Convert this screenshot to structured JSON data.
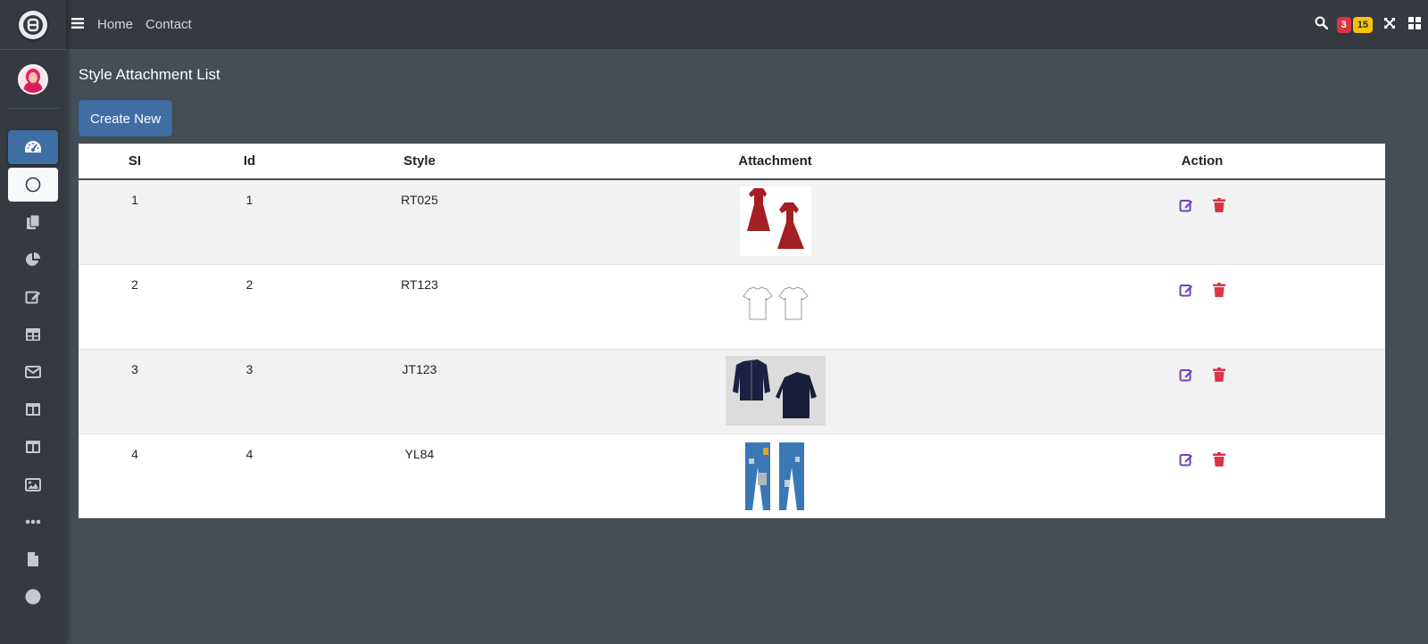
{
  "nav": {
    "links": [
      "Home",
      "Contact"
    ],
    "badges": {
      "notifications": "3",
      "messages": "15"
    }
  },
  "sidebar": {
    "icons": [
      "dashboard-icon",
      "circle-icon",
      "copy-icon",
      "chart-pie-icon",
      "edit-icon",
      "table-icon",
      "envelope-icon",
      "columns-icon",
      "columns-icon",
      "image-icon",
      "ellipsis-icon",
      "file-icon",
      "circle-filled-icon"
    ]
  },
  "page": {
    "title": "Style Attachment List",
    "create_label": "Create New"
  },
  "table": {
    "headers": [
      "SI",
      "Id",
      "Style",
      "Attachment",
      "Action"
    ],
    "rows": [
      {
        "si": "1",
        "id": "1",
        "style": "RT025",
        "attachment": "red-dress-image"
      },
      {
        "si": "2",
        "id": "2",
        "style": "RT123",
        "attachment": "white-tshirt-image"
      },
      {
        "si": "3",
        "id": "3",
        "style": "JT123",
        "attachment": "denim-jacket-image"
      },
      {
        "si": "4",
        "id": "4",
        "style": "YL84",
        "attachment": "jeans-image"
      }
    ]
  },
  "colors": {
    "edit": "#6f42c1",
    "delete": "#dc3545",
    "primary": "#3f6ea5"
  }
}
